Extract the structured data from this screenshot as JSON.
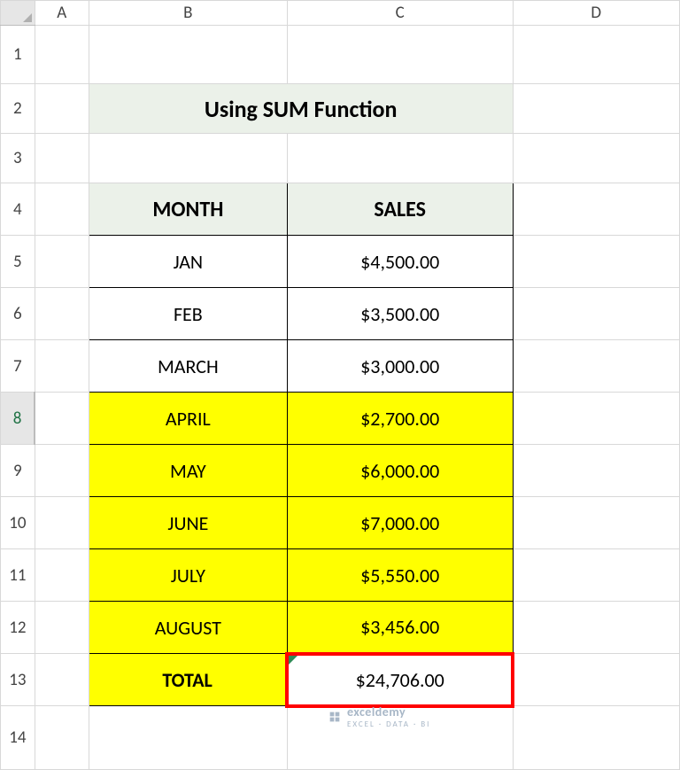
{
  "columns": [
    "A",
    "B",
    "C",
    "D"
  ],
  "rows": [
    "1",
    "2",
    "3",
    "4",
    "5",
    "6",
    "7",
    "8",
    "9",
    "10",
    "11",
    "12",
    "13",
    "14"
  ],
  "title": "Using SUM Function",
  "headers": {
    "month": "MONTH",
    "sales": "SALES"
  },
  "data": [
    {
      "month": "JAN",
      "sales": "$4,500.00",
      "hl": false
    },
    {
      "month": "FEB",
      "sales": "$3,500.00",
      "hl": false
    },
    {
      "month": "MARCH",
      "sales": "$3,000.00",
      "hl": false
    },
    {
      "month": "APRIL",
      "sales": "$2,700.00",
      "hl": true
    },
    {
      "month": "MAY",
      "sales": "$6,000.00",
      "hl": true
    },
    {
      "month": "JUNE",
      "sales": "$7,000.00",
      "hl": true
    },
    {
      "month": "JULY",
      "sales": "$5,550.00",
      "hl": true
    },
    {
      "month": "AUGUST",
      "sales": "$3,456.00",
      "hl": true
    }
  ],
  "total": {
    "label": "TOTAL",
    "value": "$24,706.00",
    "hl": true
  },
  "watermark": {
    "brand": "exceldemy",
    "tag": "EXCEL · DATA · BI"
  },
  "chart_data": {
    "type": "table",
    "title": "Using SUM Function",
    "categories": [
      "JAN",
      "FEB",
      "MARCH",
      "APRIL",
      "MAY",
      "JUNE",
      "JULY",
      "AUGUST"
    ],
    "values": [
      4500.0,
      3500.0,
      3000.0,
      2700.0,
      6000.0,
      7000.0,
      5550.0,
      3456.0
    ],
    "xlabel": "MONTH",
    "ylabel": "SALES",
    "total": 24706.0
  }
}
